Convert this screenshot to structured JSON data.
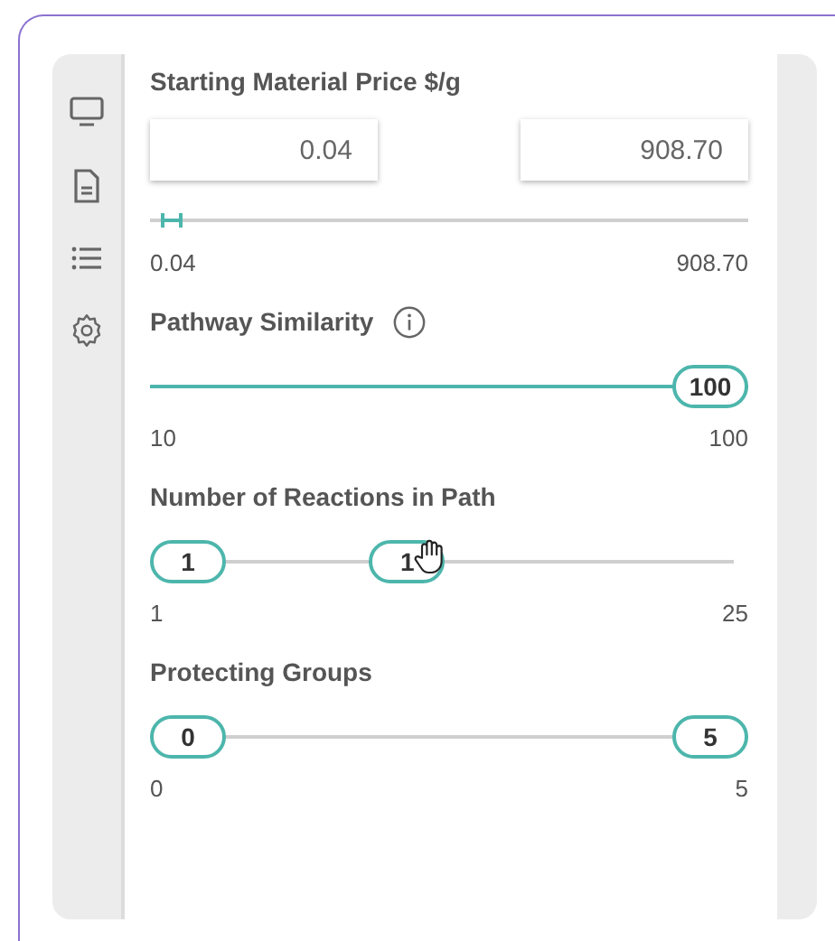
{
  "filters": [
    {
      "kind": "price",
      "title": "Starting Material Price $/g",
      "info": false,
      "inputs": [
        "0.04",
        "908.70"
      ],
      "thumbs": [
        {
          "level": 0.02
        },
        {
          "level": 0.05
        }
      ],
      "track_active": true,
      "min_label": "0.04",
      "max_label": "908.70"
    },
    {
      "kind": "bubbles",
      "title": "Pathway Similarity",
      "info": true,
      "thumbs": [
        {
          "level": 1,
          "label": "100",
          "hovered": false
        }
      ],
      "track_active": true,
      "min_label": "10",
      "max_label": "100"
    },
    {
      "kind": "bubbles",
      "title": "Number of Reactions in Path",
      "info": false,
      "thumbs": [
        {
          "level": 0,
          "label": "1",
          "hovered": false
        },
        {
          "level": 0.42,
          "label": "1",
          "hovered": true
        }
      ],
      "track_active": false,
      "min_label": "1",
      "max_label": "25"
    },
    {
      "kind": "bubbles",
      "title": "Protecting Groups",
      "info": false,
      "thumbs": [
        {
          "level": 0,
          "label": "0",
          "hovered": false
        },
        {
          "level": 1,
          "label": "5",
          "hovered": false
        }
      ],
      "track_active": false,
      "min_label": "0",
      "max_label": "5"
    }
  ]
}
